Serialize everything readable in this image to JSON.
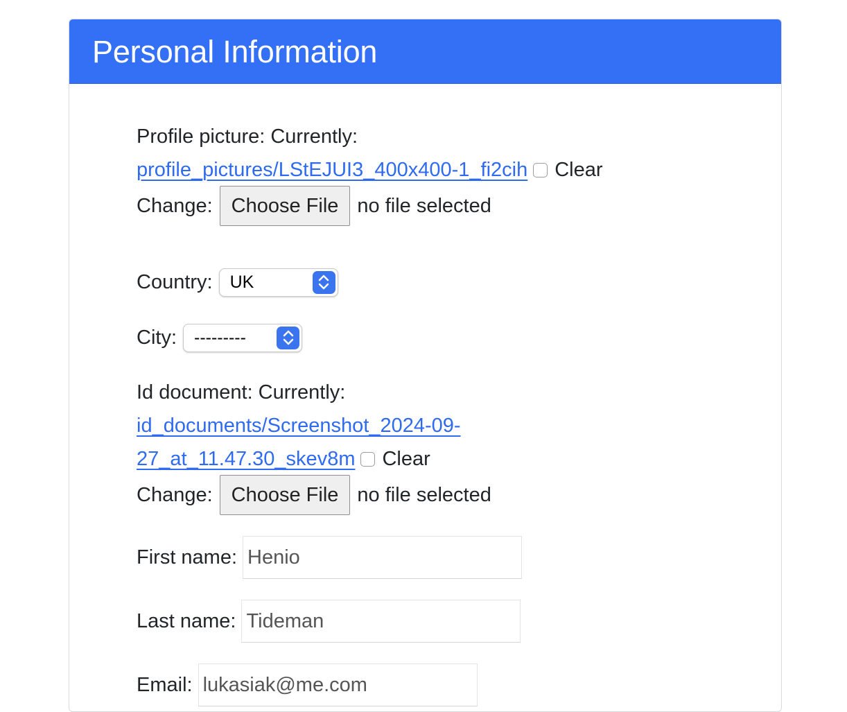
{
  "header": {
    "title": "Personal Information"
  },
  "profile_picture": {
    "label": "Profile picture:",
    "currently_label": "Currently:",
    "file_link": "profile_pictures/LStEJUI3_400x400-1_fi2cih",
    "clear_label": "Clear",
    "change_label": "Change:",
    "choose_button": "Choose File",
    "file_status": "no file selected"
  },
  "country": {
    "label": "Country:",
    "selected": "UK"
  },
  "city": {
    "label": "City:",
    "selected": "---------"
  },
  "id_document": {
    "label": "Id document:",
    "currently_label": "Currently:",
    "file_link_line1": "id_documents/Screenshot_2024-09-",
    "file_link_line2": "27_at_11.47.30_skev8m",
    "clear_label": "Clear",
    "change_label": "Change:",
    "choose_button": "Choose File",
    "file_status": "no file selected"
  },
  "first_name": {
    "label": "First name:",
    "value": "Henio"
  },
  "last_name": {
    "label": "Last name:",
    "value": "Tideman"
  },
  "email": {
    "label": "Email:",
    "value": "lukasiak@me.com"
  },
  "colors": {
    "header_background": "#3370f5",
    "link": "#2f6bf0",
    "select_arrow": "#3a75ef"
  }
}
